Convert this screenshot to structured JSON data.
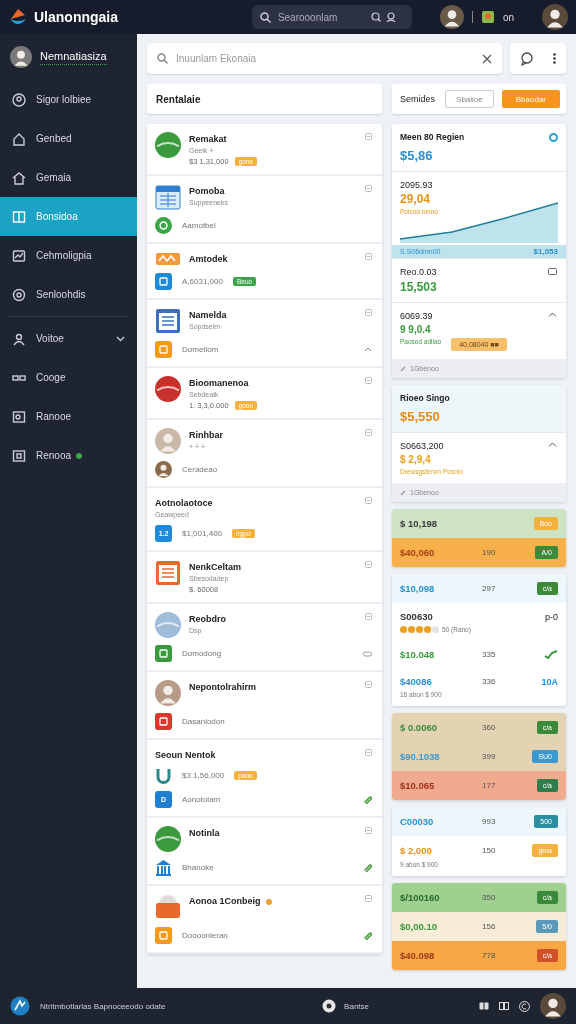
{
  "header": {
    "logo_text": "Ulanonngaia",
    "search": {
      "placeholder": "Searooonlam"
    },
    "status_text": "on"
  },
  "sidebar": {
    "user": {
      "name": "Nemnatiasiza"
    },
    "items": [
      {
        "label": "Sigor lolbiee",
        "kind": "link",
        "selected": false
      },
      {
        "label": "Genbed",
        "kind": "link",
        "selected": false
      },
      {
        "label": "Gemaia",
        "kind": "link",
        "selected": false
      },
      {
        "label": "Bonsidoa",
        "kind": "link",
        "selected": true
      },
      {
        "label": "Cehmoligpia",
        "kind": "link",
        "selected": false
      },
      {
        "label": "Senloohdis",
        "kind": "link",
        "selected": false
      },
      {
        "label": "Voitoe",
        "kind": "group",
        "selected": false
      },
      {
        "label": "Cooge",
        "kind": "link",
        "selected": false
      },
      {
        "label": "Ranooe",
        "kind": "link",
        "selected": false
      },
      {
        "label": "Renooa",
        "kind": "link",
        "selected": false,
        "color": "#3aa648"
      }
    ]
  },
  "search": {
    "placeholder": "Inuunlam Ekonaia"
  },
  "heading": "Rentalaie",
  "toolbar": {
    "label": "Semides",
    "buttons": [
      {
        "label": "Sbalioe",
        "kind": "outline"
      },
      {
        "label": "Bbaodar",
        "kind": "primary"
      }
    ]
  },
  "list": [
    {
      "icon": {
        "kind": "ball",
        "color": "#3a9a3e"
      },
      "title": "Remakat",
      "subtitle": "Geeik +",
      "detail": "$3 1,31,000",
      "badge": {
        "text": "gone",
        "color": "#f5b13d"
      }
    },
    {
      "icon": {
        "kind": "calendar",
        "color": "#2f7fd0"
      },
      "title": "Pomoba",
      "subtitle": "Suppeeneks",
      "sub_rows": [
        {
          "kind": "plain",
          "icon": {
            "kind": "round",
            "color": "#3aa648"
          },
          "text": "Aamotbel"
        }
      ]
    },
    {
      "icon": {
        "kind": "wave",
        "color": "#f39a3c"
      },
      "title": "Amtodek",
      "sub_rows": [
        {
          "kind": "plain",
          "icon": {
            "kind": "tile",
            "color": "#1f8ad8"
          },
          "text": "A,6031,000",
          "badge": {
            "text": "Beuo",
            "color": "#3aa648"
          }
        }
      ]
    },
    {
      "icon": {
        "kind": "document",
        "color": "#3a6fc0"
      },
      "title": "Namelda",
      "subtitle": "Sopdseim",
      "sub_rows": [
        {
          "kind": "caret",
          "icon": {
            "kind": "tile",
            "color": "#f29a1a"
          },
          "text": "Dometiom"
        }
      ]
    },
    {
      "icon": {
        "kind": "ball",
        "color": "#c8302c"
      },
      "title": "Bioomanenoa",
      "subtitle": "Sebdeatk",
      "detail": "1: 3,3,0.000",
      "badge": {
        "text": "gooo",
        "color": "#f5b13d"
      }
    },
    {
      "icon": {
        "kind": "avatar",
        "color": "#c9b8a8"
      },
      "title": "Rinhbar",
      "subtitle": "+ + +",
      "sub_rows": [
        {
          "kind": "plain",
          "icon": {
            "kind": "avatar",
            "color": "#8a6a4a"
          },
          "text": "Ceradeao"
        }
      ]
    },
    {
      "title": "Aotnolaotoce",
      "subtitle": "Geawpeed",
      "sub_rows": [
        {
          "kind": "plain",
          "icon": {
            "kind": "tile",
            "color": "#1f8ad8",
            "glyph": "1.2"
          },
          "text": "$1,001,400",
          "badge": {
            "text": "ngpo",
            "color": "#f5b13d"
          }
        }
      ]
    },
    {
      "icon": {
        "kind": "document",
        "color": "#e8692c"
      },
      "title": "NenkCeltam",
      "subtitle": "Sbesodadep",
      "detail": "$. 60008"
    },
    {
      "icon": {
        "kind": "ball",
        "color": "#9fbcd8"
      },
      "title": "Reobdro",
      "subtitle": "Dsp",
      "sub_rows": [
        {
          "kind": "link",
          "icon": {
            "kind": "tile",
            "color": "#3a9a3e"
          },
          "text": "Domodong"
        }
      ]
    },
    {
      "icon": {
        "kind": "avatar",
        "color": "#b89a88"
      },
      "title": "Nepontolrahirm",
      "sub_rows": [
        {
          "kind": "plain",
          "icon": {
            "kind": "tile",
            "color": "#d9382c"
          },
          "text": "Dasanlodon"
        }
      ]
    },
    {
      "title": "Seoun Nentok",
      "sub_rows": [
        {
          "kind": "plain",
          "icon": {
            "kind": "ushape",
            "color": "#2a8a8a"
          },
          "text": "$3 1,56,000",
          "badge": {
            "text": "pano",
            "color": "#f5b13d"
          }
        },
        {
          "kind": "clip",
          "icon": {
            "kind": "tile",
            "color": "#1f7fd0",
            "glyph": "D"
          },
          "text": "Aonotolam"
        }
      ]
    },
    {
      "icon": {
        "kind": "ball",
        "color": "#3a9a3e"
      },
      "title": "Notinla",
      "sub_rows": [
        {
          "kind": "clip",
          "icon": {
            "kind": "bank",
            "color": "#1f7fd0"
          },
          "text": "Bhanoke"
        }
      ]
    },
    {
      "icon": {
        "kind": "folder",
        "color": "#e8692c"
      },
      "title": "Aonoa 1Conbeig",
      "color": "#f0a030",
      "sub_rows": [
        {
          "kind": "clip",
          "icon": {
            "kind": "tile",
            "color": "#f29a1a"
          },
          "text": "Doooonleran"
        }
      ]
    }
  ],
  "summary_cards": [
    {
      "title": "Meen 80 Regien",
      "color": "#2a9fd6",
      "value": {
        "text": "$5,86",
        "color": "#2a8fd0"
      },
      "sections": [
        {
          "kind": "chart",
          "label": "2095.93",
          "value": {
            "text": "29,04",
            "color": "#e8951a"
          },
          "note": "Poicod tonno",
          "footer_left": "S.S06dmn00",
          "footer_right": "$1,053"
        },
        {
          "kind": "plain",
          "label": "Reo.0.03",
          "value": {
            "text": "15,503",
            "color": "#3a9a3e"
          }
        },
        {
          "kind": "expander",
          "label": "6069.39",
          "value": {
            "text": "9 9,0.4",
            "color": "#3a9a3e"
          },
          "note": "Paosod adilao",
          "badge": "40,08040 ■■"
        }
      ],
      "footer": "1Gbenoo"
    },
    {
      "title": "Rioeo Singo",
      "value": {
        "text": "$5,550",
        "color": "#e88a1a"
      },
      "sections": [
        {
          "kind": "expander",
          "label": "S0663,200",
          "value": {
            "text": "$ 2,9,4",
            "color": "#e8a01a"
          },
          "note": "Drewsgsterwn Posnio"
        }
      ],
      "footer": "1Gbenoo"
    }
  ],
  "value_groups": [
    {
      "rows": [
        {
          "kind": "badge",
          "amount": {
            "text": "$ 10,198",
            "color": "#3a3a3a"
          },
          "color": "#cde3c4",
          "badge": {
            "text": "Boo",
            "color": "#f5b13d"
          }
        },
        {
          "kind": "badge",
          "amount": {
            "text": "$40,060",
            "color": "#a8401a"
          },
          "count": "190",
          "color": "#f7b04a",
          "badge": {
            "text": "A/0",
            "color": "#3a8a3a"
          }
        }
      ]
    },
    {
      "rows": [
        {
          "kind": "badge",
          "amount": {
            "text": "$10,098",
            "color": "#2a8fd0"
          },
          "count": "297",
          "color": "#eef7fb",
          "badge": {
            "text": "c/a",
            "color": "#3a8a3a"
          }
        },
        {
          "kind": "rating",
          "amount": {
            "text": "S00630",
            "color": "#333333"
          },
          "code": "p-0",
          "stars": 4,
          "note": "50 (Rano)",
          "color": "#ffffff"
        },
        {
          "kind": "check",
          "amount": {
            "text": "$10.048",
            "color": "#3a9a3e"
          },
          "count": "335",
          "color": "#ffffff"
        },
        {
          "kind": "text",
          "amount": {
            "text": "$40086",
            "color": "#2a8fd0"
          },
          "count": "336",
          "code": "10A",
          "note": "16 abon $ 900",
          "color": "#ffffff"
        }
      ]
    },
    {
      "rows": [
        {
          "kind": "badge",
          "amount": {
            "text": "$ 0.0060",
            "color": "#3a8a3a"
          },
          "count": "360",
          "color": "#e3d3b3",
          "badge": {
            "text": "c/a",
            "color": "#3a8a3a"
          }
        },
        {
          "kind": "badge",
          "amount": {
            "text": "$90.1038",
            "color": "#3a9ad0"
          },
          "count": "399",
          "color": "#e3d3b3",
          "badge": {
            "text": "SU0",
            "color": "#3a9ad0"
          }
        },
        {
          "kind": "badge",
          "amount": {
            "text": "$10.065",
            "color": "#a03020"
          },
          "count": "177",
          "color": "#f0ab8e",
          "badge": {
            "text": "c/a",
            "color": "#2e7d4a"
          }
        }
      ]
    },
    {
      "rows": [
        {
          "kind": "badge",
          "amount": {
            "text": "C00030",
            "color": "#2a8fd0"
          },
          "count": "993",
          "color": "#eef7fb",
          "badge": {
            "text": "500",
            "color": "#2a8fa0"
          }
        },
        {
          "kind": "badge",
          "amount": {
            "text": "$ 2,000",
            "color": "#e8901a"
          },
          "count": "150",
          "note": "9 abon $ 900",
          "color": "#ffffff",
          "badge": {
            "text": "gma",
            "color": "#f5b13d"
          }
        }
      ]
    },
    {
      "rows": [
        {
          "kind": "badge",
          "amount": {
            "text": "$/100160",
            "color": "#2a6a2a"
          },
          "count": "350",
          "color": "#9fd08f",
          "badge": {
            "text": "c/a",
            "color": "#3a8a3a"
          }
        },
        {
          "kind": "badge",
          "amount": {
            "text": "$0,00.10",
            "color": "#3a9a3e"
          },
          "count": "156",
          "color": "#f6ecd8",
          "badge": {
            "text": "5/0",
            "color": "#5a9ab8"
          }
        },
        {
          "kind": "badge",
          "amount": {
            "text": "$40.098",
            "color": "#a03a1a"
          },
          "count": "778",
          "color": "#f7a845",
          "badge": {
            "text": "c/a",
            "color": "#d0502a"
          }
        }
      ]
    }
  ],
  "footer": {
    "text": "Ntritmbotlarlas Bapnoceeodo odate",
    "status": "Bantse"
  }
}
